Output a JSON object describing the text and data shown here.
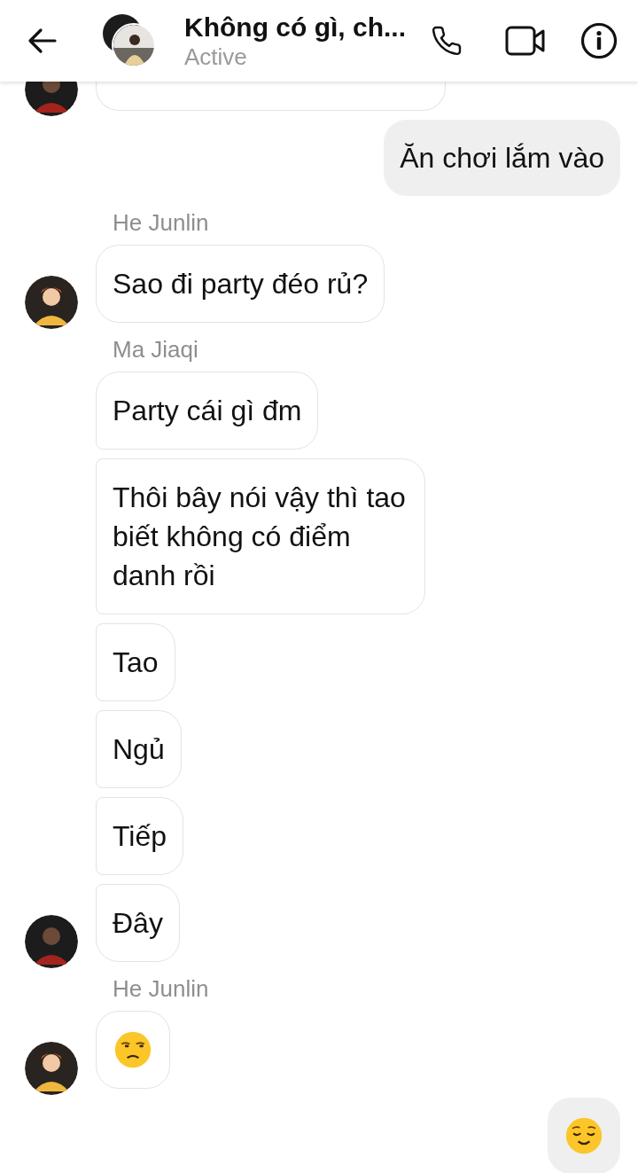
{
  "header": {
    "title": "Không có gì, ch...",
    "status": "Active"
  },
  "groups": [
    {
      "kind": "incoming",
      "avatar": true,
      "bubbles": [
        {
          "kind": "partial"
        }
      ]
    },
    {
      "kind": "outgoing",
      "bubbles": [
        {
          "kind": "text",
          "text": "Ăn chơi lắm vào"
        }
      ]
    },
    {
      "kind": "incoming",
      "sender": "He Junlin",
      "avatar": true,
      "bubbles": [
        {
          "kind": "text",
          "text": "Sao đi party đéo rủ?"
        }
      ]
    },
    {
      "kind": "incoming",
      "sender": "Ma Jiaqi",
      "avatar": true,
      "bubbles": [
        {
          "kind": "text",
          "text": "Party cái gì đm"
        },
        {
          "kind": "text",
          "text": "Thôi bây nói vậy thì tao biết không có điểm danh rồi"
        },
        {
          "kind": "text",
          "text": "Tao"
        },
        {
          "kind": "text",
          "text": "Ngủ"
        },
        {
          "kind": "text",
          "text": "Tiếp"
        },
        {
          "kind": "text",
          "text": "Đây"
        }
      ]
    },
    {
      "kind": "incoming",
      "sender": "He Junlin",
      "avatar": true,
      "bubbles": [
        {
          "kind": "unamused"
        }
      ]
    },
    {
      "kind": "outgoing",
      "bubbles": [
        {
          "kind": "relieved"
        }
      ]
    }
  ]
}
